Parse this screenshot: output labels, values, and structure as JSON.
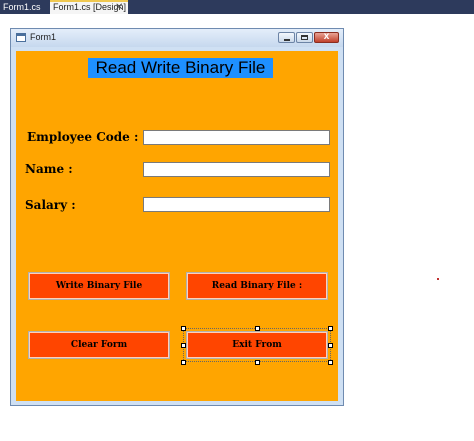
{
  "ide": {
    "tabs": [
      {
        "label": "Form1.cs"
      },
      {
        "label": "Form1.cs [Design]"
      }
    ]
  },
  "window": {
    "title": "Form1"
  },
  "form": {
    "heading": "Read Write Binary File",
    "fields": {
      "employee_code": {
        "label": "Employee Code :",
        "value": ""
      },
      "name": {
        "label": "Name :",
        "value": ""
      },
      "salary": {
        "label": "Salary :",
        "value": ""
      }
    },
    "buttons": {
      "write": "Write Binary File",
      "read": "Read Binary File :",
      "clear": "Clear Form",
      "exit": "Exit From"
    }
  },
  "colors": {
    "form_background": "#ffa500",
    "heading_background": "#1e90ff",
    "button_background": "#ff4500"
  }
}
